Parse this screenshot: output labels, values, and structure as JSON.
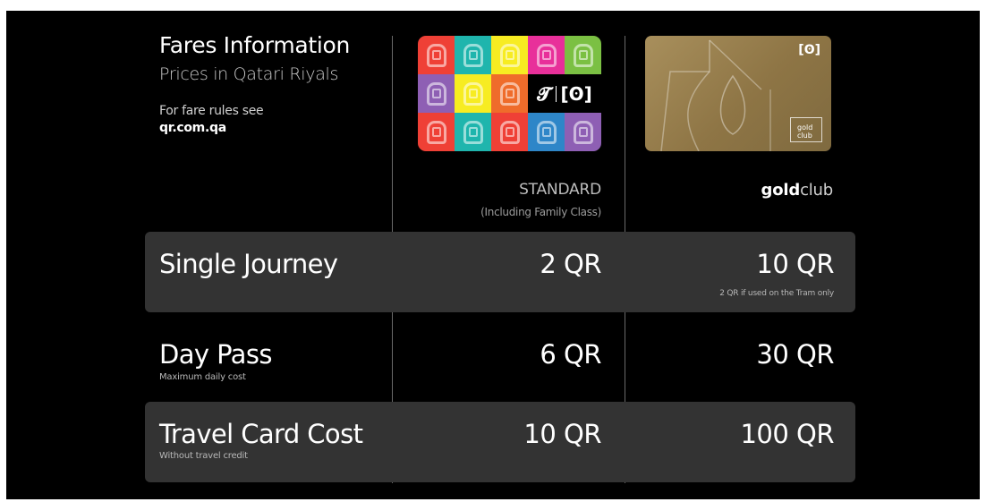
{
  "header": {
    "title": "Fares Information",
    "subtitle": "Prices in Qatari Riyals",
    "rules_text": "For fare rules see",
    "rules_link": "qr.com.qa"
  },
  "columns": {
    "standard": {
      "label": "STANDARD",
      "sublabel": "(Including Family Class)"
    },
    "gold": {
      "label_bold": "gold",
      "label_light": "club"
    }
  },
  "cards": {
    "standard_tile_colors": [
      "#ef4036",
      "#1fb5ad",
      "#f7ec22",
      "#e8309a",
      "#7bc043",
      "#8e5fb4",
      "#f7ec22",
      "#ef6c2b",
      "#ef4036",
      "#1fb5ad",
      "#ef4036",
      "#2e86c8",
      "#8e5fb4",
      "#7bc043"
    ],
    "gold_badge_text": "gold club",
    "icon_std": "tram-logo-icon",
    "icon_metro": "metro-logo-icon"
  },
  "rows": [
    {
      "label": "Single Journey",
      "note": "",
      "standard": "2 QR",
      "gold": "10 QR",
      "gold_note": "2 QR if used on the Tram only"
    },
    {
      "label": "Day Pass",
      "note": "Maximum daily cost",
      "standard": "6 QR",
      "gold": "30 QR",
      "gold_note": ""
    },
    {
      "label": "Travel Card Cost",
      "note": "Without travel credit",
      "standard": "10 QR",
      "gold": "100 QR",
      "gold_note": ""
    }
  ],
  "colors": {
    "background": "#000000",
    "row_shade": "#333333",
    "gold_card": "#a88f5c"
  }
}
